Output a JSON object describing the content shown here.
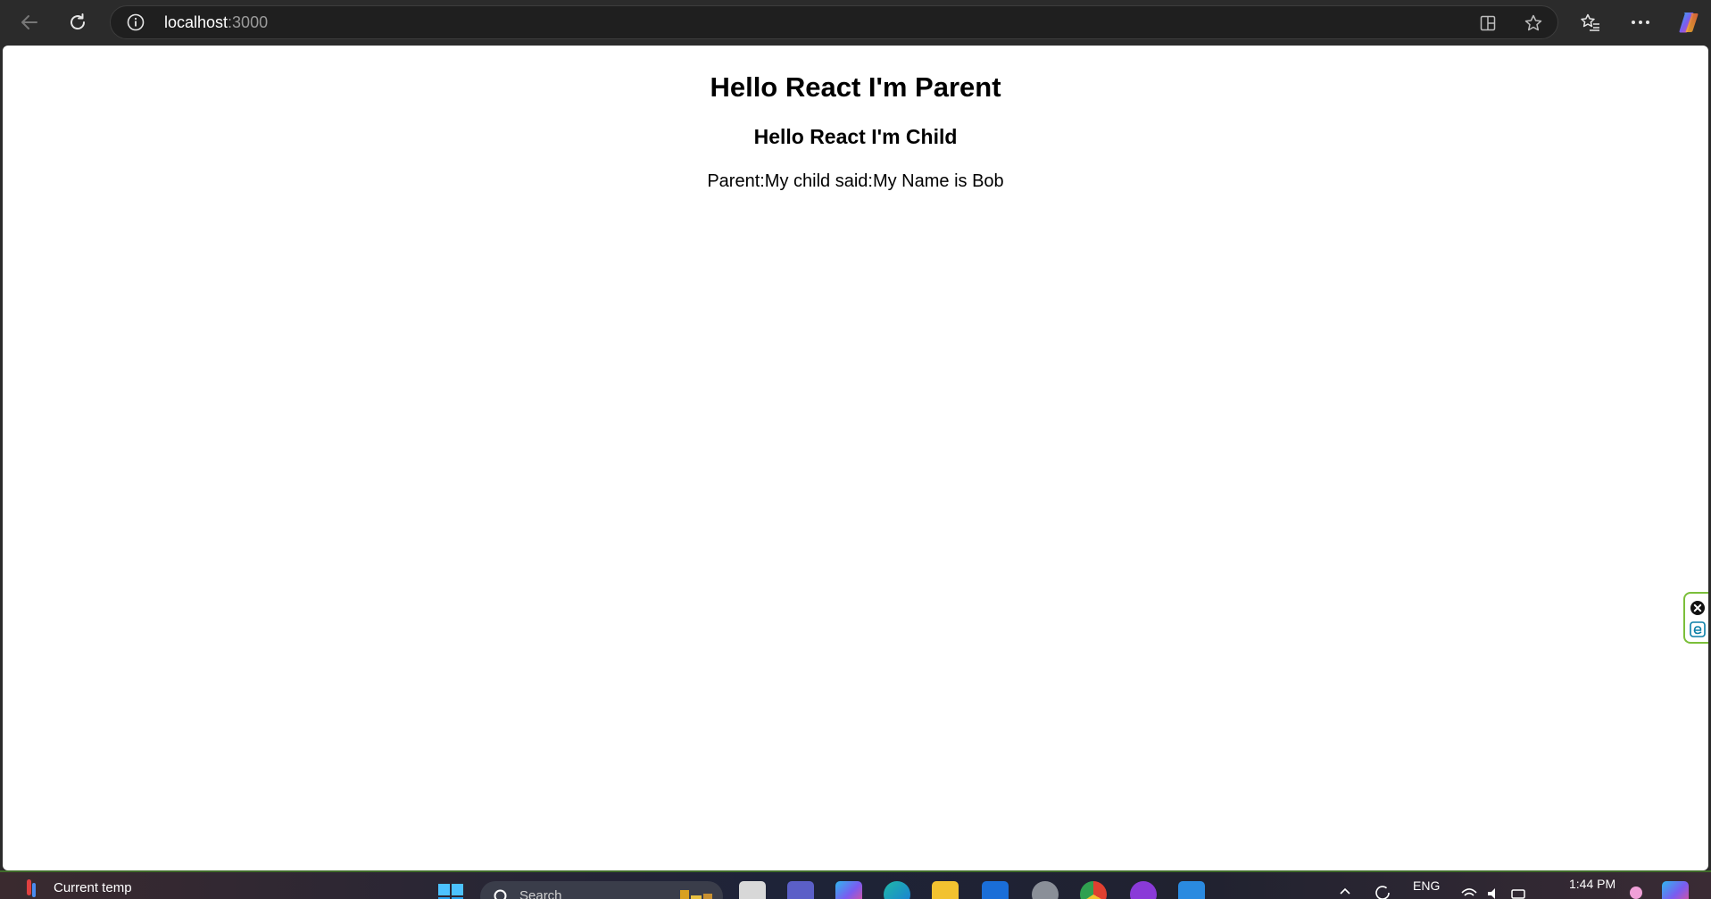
{
  "browser": {
    "url_host": "localhost",
    "url_port": ":3000",
    "icons": {
      "back": "arrow-left-icon",
      "refresh": "refresh-icon",
      "site_info": "info-icon",
      "split_screen": "split-screen-icon",
      "favorite": "star-icon",
      "favorites_list": "favorites-icon",
      "more": "ellipsis-icon",
      "copilot": "copilot-icon"
    }
  },
  "page": {
    "parent_heading": "Hello React I'm Parent",
    "child_heading": "Hello React I'm Child",
    "message": "Parent:My child said:My Name is Bob"
  },
  "side_widget": {
    "icons": [
      "close-circle-icon",
      "edge-icon"
    ],
    "accent": "#7bbf3a"
  },
  "taskbar": {
    "weather_label": "Current temp",
    "search_placeholder": "Search",
    "language": "ENG",
    "time": "1:44 PM"
  }
}
